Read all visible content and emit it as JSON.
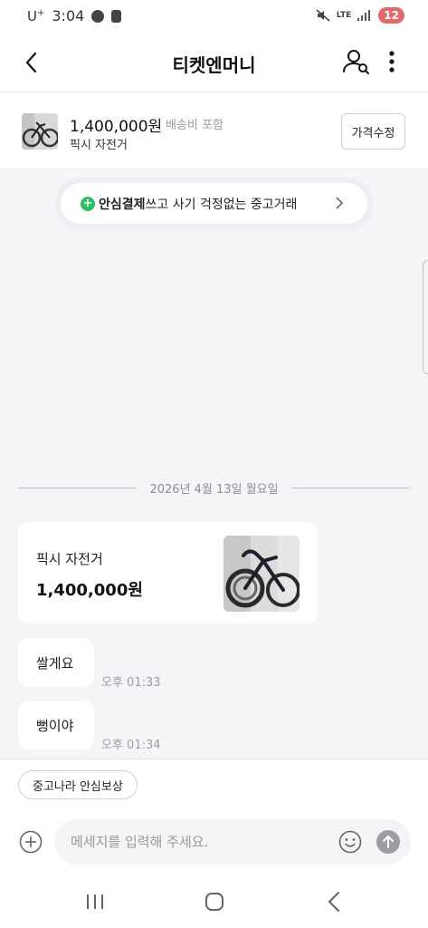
{
  "status_bar": {
    "carrier": "U",
    "carrier_sup": "+",
    "time": "3:04",
    "network": "LTE",
    "battery": "12",
    "battery_color": "#e06b6b"
  },
  "header": {
    "title": "티켓엔머니",
    "icons": [
      "back-icon",
      "profile-search-icon",
      "more-vertical-icon"
    ]
  },
  "product": {
    "price": "1,400,000원",
    "shipping": "배송비 포함",
    "name": "픽시 자전거",
    "edit_price_label": "가격수정"
  },
  "safe_banner": {
    "bold_text": "안심결제",
    "text": "쓰고 사기 걱정없는 중고거래",
    "icon_color": "#2fbf63"
  },
  "chat": {
    "date": "2026년 4월 13일 월요일",
    "product_card": {
      "name": "픽시 자전거",
      "price": "1,400,000원"
    },
    "messages": [
      {
        "text": "쌀게요",
        "time": "오후 01:33"
      },
      {
        "text": "뻥이야",
        "time": "오후 01:34"
      }
    ]
  },
  "bottom": {
    "chip_label": "중고나라 안심보상",
    "input_placeholder": "메세지를 입력해 주세요."
  },
  "nav": {
    "icons": [
      "recents-icon",
      "home-icon",
      "back-nav-icon"
    ]
  }
}
